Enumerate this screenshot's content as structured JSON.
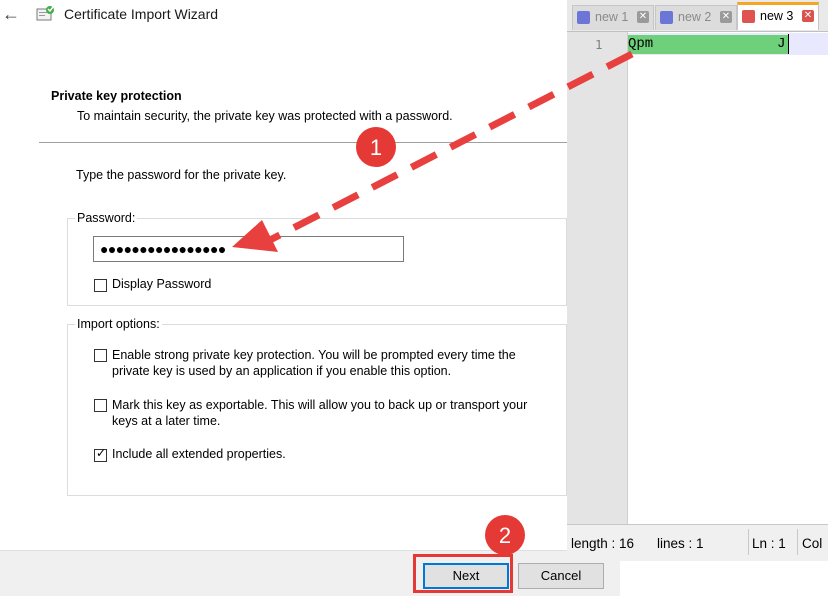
{
  "window": {
    "title": "Certificate Import Wizard",
    "icon": "certificate-icon",
    "back_icon": "back-arrow-icon"
  },
  "section": {
    "heading": "Private key protection",
    "subheading": "To maintain security, the private key was protected with a password."
  },
  "prompt": "Type the password for the private key.",
  "password_group": {
    "legend": "Password:",
    "value": "●●●●●●●●●●●●●●●●",
    "display_password_label": "Display Password",
    "display_password_checked": false
  },
  "import_options": {
    "legend": "Import options:",
    "options": [
      {
        "label": "Enable strong private key protection. You will be prompted every time the private key is used by an application if you enable this option.",
        "checked": false
      },
      {
        "label": "Mark this key as exportable. This will allow you to back up or transport your keys at a later time.",
        "checked": false
      },
      {
        "label": "Include all extended properties.",
        "checked": true
      }
    ]
  },
  "buttons": {
    "next": "Next",
    "cancel": "Cancel"
  },
  "editor": {
    "tabs": [
      {
        "label": "new 1",
        "active": false,
        "icon": "floppy-disk-icon",
        "close_icon": "close-icon"
      },
      {
        "label": "new 2",
        "active": false,
        "icon": "floppy-disk-icon",
        "close_icon": "close-icon"
      },
      {
        "label": "new 3",
        "active": true,
        "icon": "floppy-disk-icon",
        "close_icon": "close-icon"
      }
    ],
    "line_number": "1",
    "line_text_start": "Qpm",
    "line_text_end": "J",
    "status": {
      "length": "length : 16",
      "lines": "lines : 1",
      "ln": "Ln : 1",
      "col": "Col"
    }
  },
  "annotations": {
    "step1": "1",
    "step2": "2",
    "colors": {
      "marker": "#e53935",
      "arrow": "#e8403e",
      "highlight": "#6fd07c",
      "accent": "#0078d7"
    }
  }
}
